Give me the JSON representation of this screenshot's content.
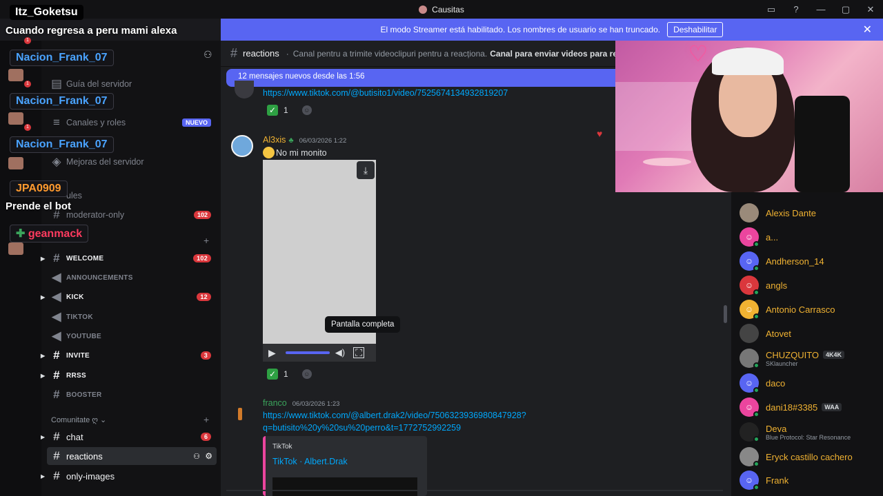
{
  "window": {
    "title": "Causitas",
    "icons": [
      "inbox-icon",
      "help-icon",
      "minimize-icon",
      "maximize-icon",
      "close-icon"
    ]
  },
  "banner": {
    "text": "El modo Streamer está habilitado. Los nombres de usuario se han truncado.",
    "button": "Deshabilitar"
  },
  "overlay": {
    "top_user": "Itz_Goketsu",
    "top_msg": "Cuando regresa a peru mami alexa",
    "users": [
      "Nacion_Frank_07",
      "Nacion_Frank_07",
      "Nacion_Frank_07"
    ],
    "user4": "JPA0909",
    "msg4": "Prende el bot",
    "user5": "geanmack"
  },
  "sidebar": {
    "items": [
      {
        "label": "Guía del servidor"
      },
      {
        "label": "Canales y roles",
        "badge": "NUEVO"
      },
      {
        "label": "Mejoras del servidor"
      },
      {
        "label": "ules"
      },
      {
        "label": "moderator-only",
        "badge": "102"
      },
      {
        "label": "WELCOME",
        "badge": "102"
      },
      {
        "label": "ANNOUNCEMENTS"
      },
      {
        "label": "KICK",
        "badge": "12"
      },
      {
        "label": "TIKTOK"
      },
      {
        "label": "YOUTUBE"
      },
      {
        "label": "INVITE",
        "badge": "3"
      },
      {
        "label": "RRSS"
      },
      {
        "label": "BOOSTER"
      },
      {
        "label": "chat",
        "badge": "6"
      },
      {
        "label": "reactions"
      },
      {
        "label": "only-images"
      }
    ],
    "category": "Comunitate ღ"
  },
  "channel": {
    "name": "reactions",
    "topic": "Canal pentru a trimite videoclipuri pentru a reacționa.",
    "topic_bold": "Canal para enviar videos para reacci"
  },
  "newbar": "12 mensajes nuevos desde las 1:56",
  "messages": [
    {
      "link": "https://www.tiktok.com/@butisito1/video/7525674134932819207",
      "reaction_count": "1"
    },
    {
      "author": "Al3xis",
      "time": "06/03/2026 1:22",
      "text": "No mi monito",
      "reaction_count": "1",
      "tooltip": "Pantalla completa"
    },
    {
      "author": "franco",
      "time": "06/03/2026 1:23",
      "link_line1": "https://www.tiktok.com/@albert.drak2/video/7506323936980847928?",
      "link_line2": "q=butisito%20y%20su%20perro&t=1772752992259",
      "embed_provider": "TikTok",
      "embed_title": "TikTok · Albert.Drak"
    }
  ],
  "members": [
    {
      "name": "Alexis Dante",
      "color": "#9a8a7a"
    },
    {
      "name": "a...",
      "color": "#eb459e"
    },
    {
      "name": "Andherson_14",
      "color": "#5865f2"
    },
    {
      "name": "angls",
      "color": "#da373c"
    },
    {
      "name": "Antonio Carrasco",
      "color": "#f0b232"
    },
    {
      "name": "Atovet",
      "color": "#444"
    },
    {
      "name": "CHUZQUITO",
      "tag": "4K4K",
      "sub": "SKlauncher",
      "color": "#777"
    },
    {
      "name": "daco",
      "color": "#5865f2"
    },
    {
      "name": "dani18#3385",
      "tag": "WAA",
      "color": "#eb459e"
    },
    {
      "name": "Deva",
      "sub": "Blue Protocol: Star Resonance",
      "color": "#222"
    },
    {
      "name": "Eryck castillo cachero",
      "color": "#888"
    },
    {
      "name": "Frank",
      "color": "#5865f2"
    }
  ]
}
